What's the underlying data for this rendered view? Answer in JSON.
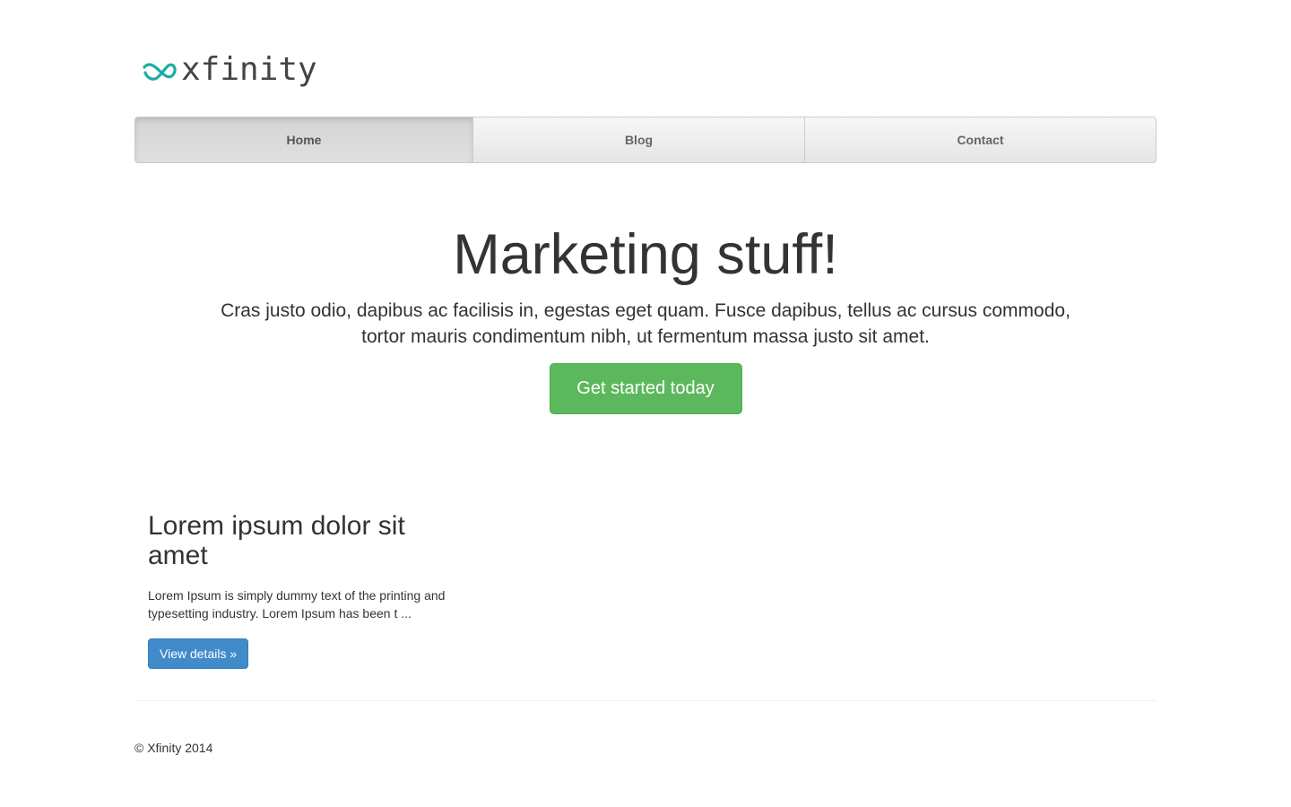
{
  "brand": {
    "name": "xfinity",
    "accent_color": "#1aae9f",
    "logo_icon": "xfinity-infinity-icon"
  },
  "nav": {
    "items": [
      {
        "label": "Home",
        "active": true
      },
      {
        "label": "Blog",
        "active": false
      },
      {
        "label": "Contact",
        "active": false
      }
    ]
  },
  "jumbotron": {
    "heading": "Marketing stuff!",
    "lead": "Cras justo odio, dapibus ac facilisis in, egestas eget quam. Fusce dapibus, tellus ac cursus commodo, tortor mauris condimentum nibh, ut fermentum massa justo sit amet.",
    "cta_label": "Get started today",
    "cta_color": "#5cb85c"
  },
  "feature": {
    "heading": "Lorem ipsum dolor sit amet",
    "body": "Lorem Ipsum is simply dummy text of the printing and typesetting industry. Lorem Ipsum has been t ...",
    "button_label": "View details »",
    "button_color": "#428bca"
  },
  "footer": {
    "copyright": "© Xfinity 2014"
  }
}
